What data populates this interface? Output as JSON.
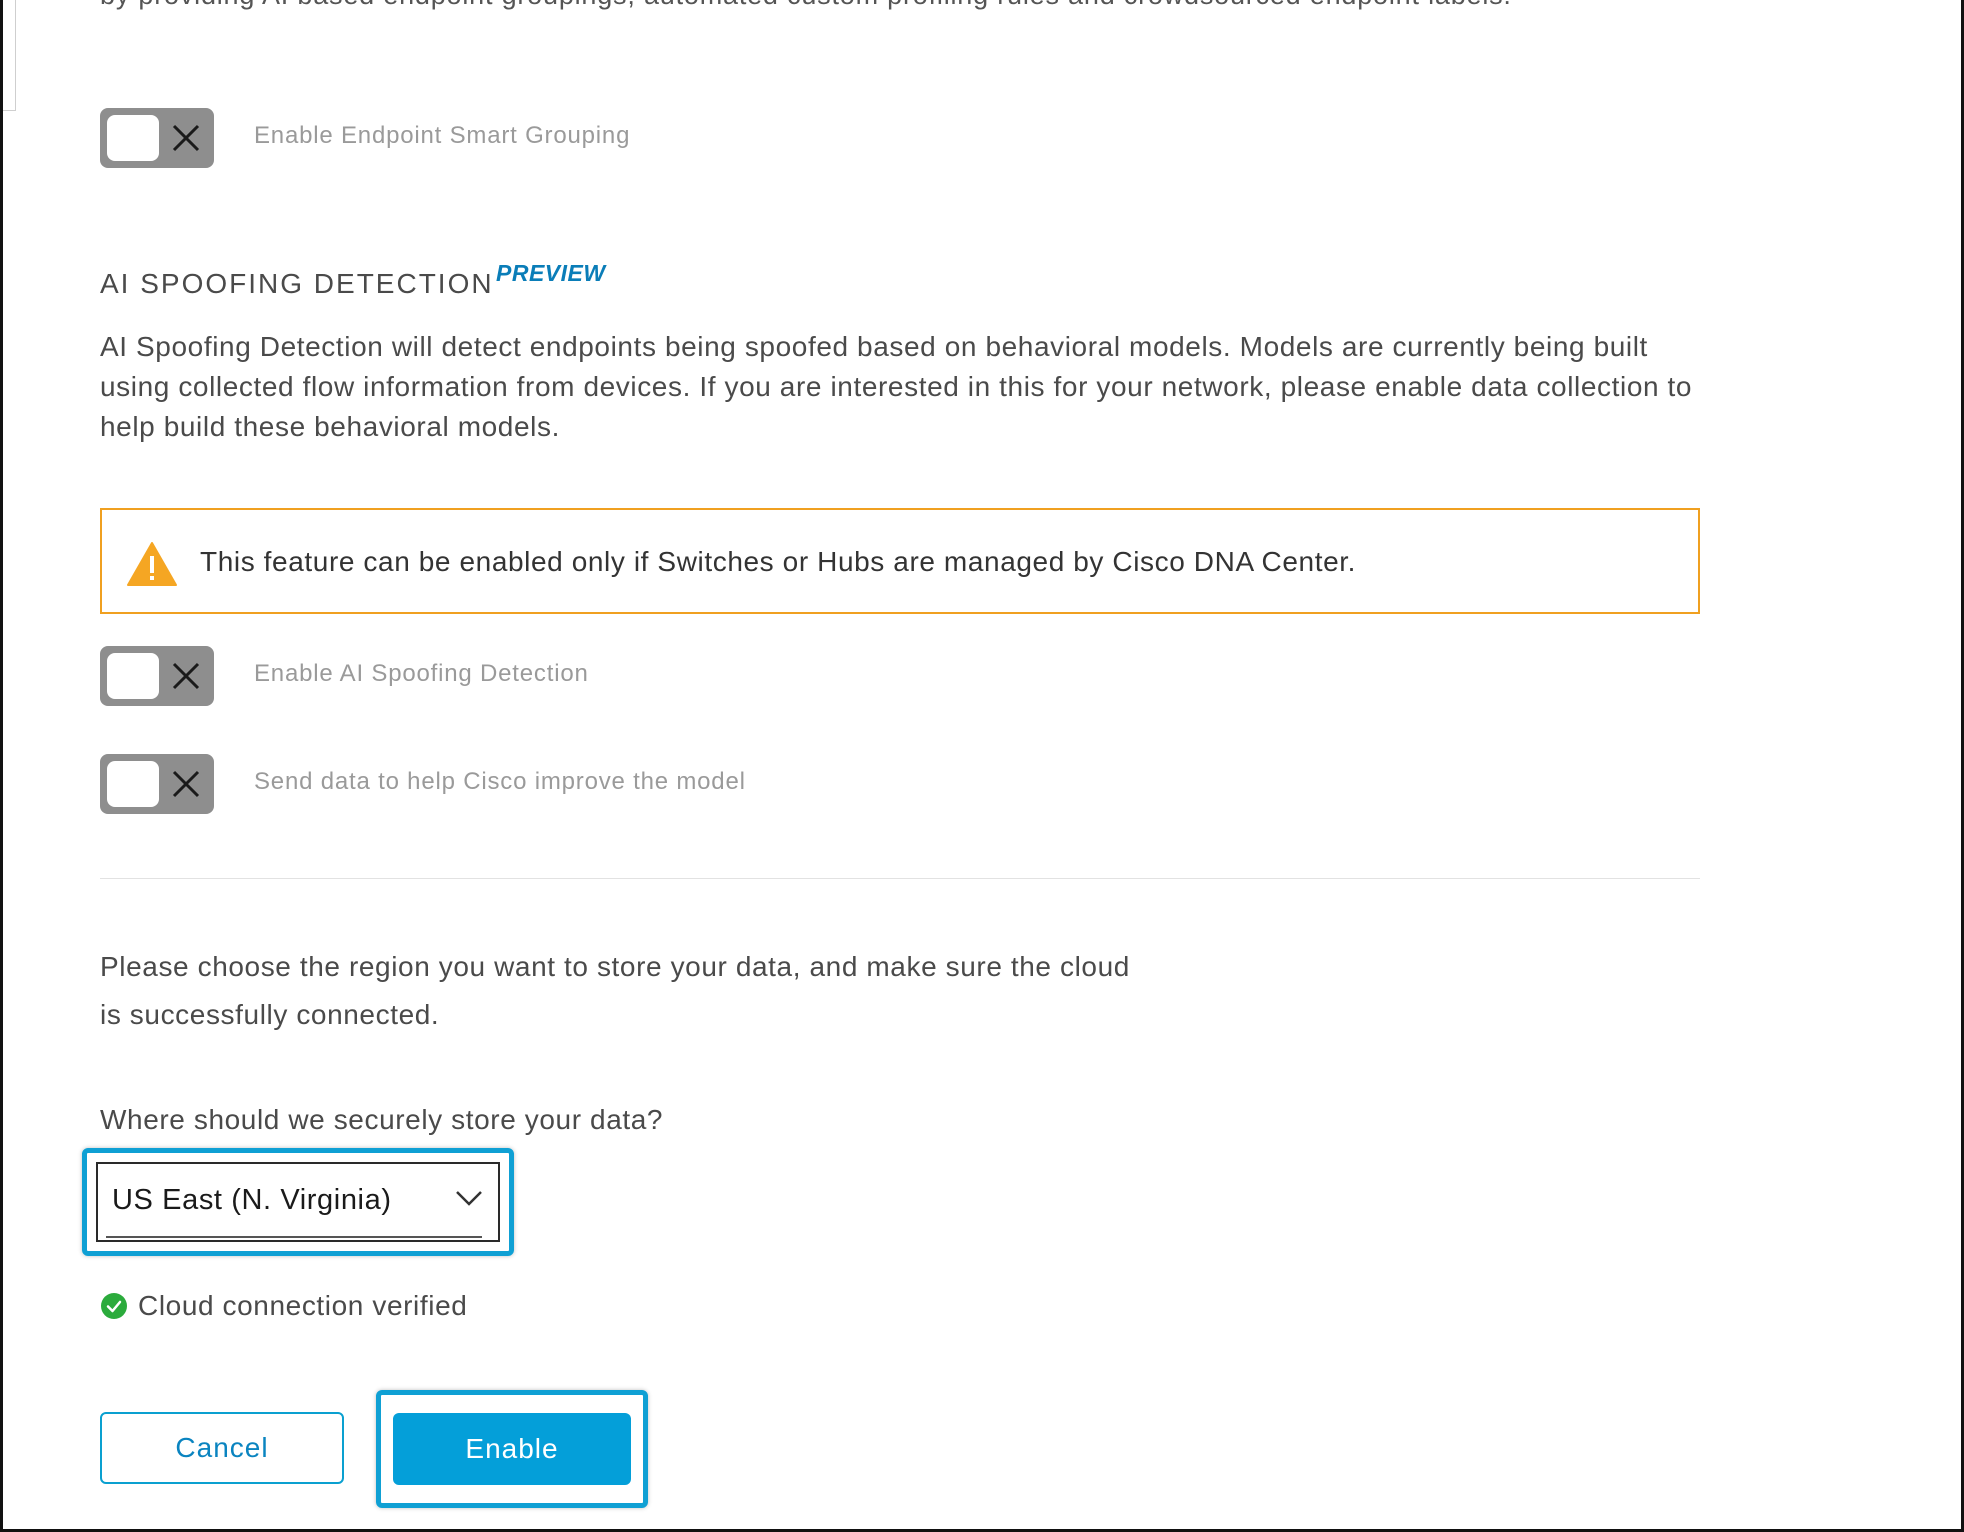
{
  "intro_cut_text": "by providing AI based endpoint groupings, automated custom profiling rules and crowdsourced endpoint labels.",
  "toggles": {
    "smart_grouping": {
      "label": "Enable Endpoint Smart Grouping",
      "on": false
    },
    "ai_spoofing": {
      "label": "Enable AI Spoofing Detection",
      "on": false
    },
    "send_data": {
      "label": "Send data to help Cisco improve the model",
      "on": false
    }
  },
  "spoofing_section": {
    "title": "AI SPOOFING DETECTION",
    "badge": "PREVIEW",
    "description": "AI Spoofing Detection will detect endpoints being spoofed based on behavioral models. Models are currently being built using collected flow information from devices. If you are interested in this for your network, please enable data collection to help build these behavioral models."
  },
  "warning": {
    "text": "This feature can be enabled only if Switches or Hubs are managed by Cisco DNA Center.",
    "color": "#f0a020"
  },
  "region": {
    "instructions": "Please choose the region you want to store your data, and make sure the cloud is successfully connected.",
    "question": "Where should we securely store your data?",
    "selected": "US East (N. Virginia)",
    "status": "Cloud connection verified",
    "status_color": "#2bab3c"
  },
  "actions": {
    "cancel_label": "Cancel",
    "enable_label": "Enable",
    "accent": "#049fd9"
  }
}
